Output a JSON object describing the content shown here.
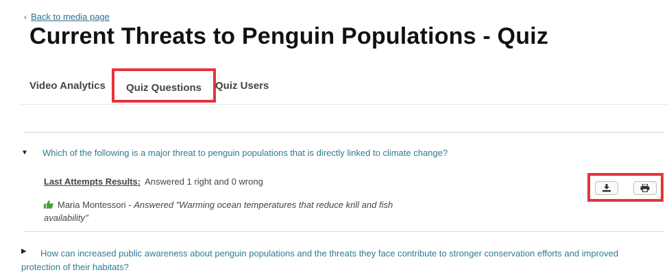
{
  "nav": {
    "back_label": "Back to media page"
  },
  "page": {
    "title": "Current Threats to Penguin Populations - Quiz"
  },
  "tabs": [
    {
      "label": "Video Analytics"
    },
    {
      "label": "Quiz Questions"
    },
    {
      "label": "Quiz Users"
    }
  ],
  "questions": [
    {
      "text": "Which of the following is a major threat to penguin populations that is directly linked to climate change?",
      "results_label": "Last Attempts Results:",
      "results_value": "Answered 1 right and 0 wrong",
      "user": "Maria Montessori",
      "answer_prefix": " - ",
      "answer": "Answered \"Warming ocean temperatures that reduce krill and fish availability\""
    },
    {
      "text": "How can increased public awareness about penguin populations and the threats they face contribute to stronger conservation efforts and improved protection of their habitats?"
    }
  ],
  "icons": {
    "back": "chevron-left-icon",
    "expanded": "caret-down-icon",
    "collapsed": "caret-right-icon",
    "correct": "thumbs-up-icon",
    "download": "download-icon",
    "print": "print-icon"
  },
  "colors": {
    "link": "#2f7a92",
    "highlight": "#e8323c",
    "thumb": "#4a9e3a"
  }
}
